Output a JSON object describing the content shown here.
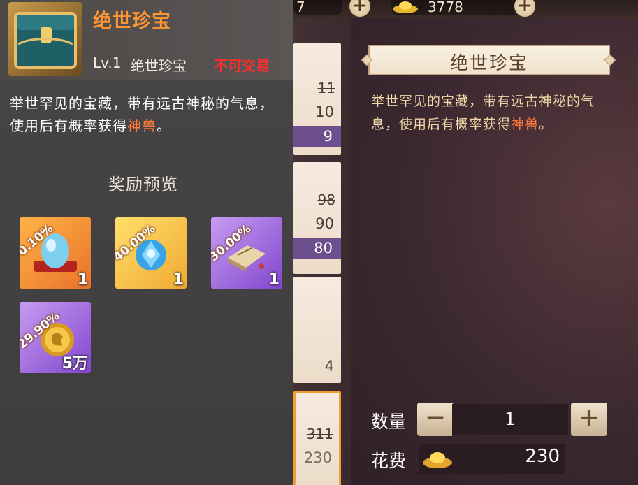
{
  "top_bar": {
    "currency_a_value": "7",
    "currency_b_value": "3778",
    "plus_symbol": "+"
  },
  "shop_list": {
    "items": [
      {
        "old_price": "11",
        "price": "10",
        "discount_price": "9"
      },
      {
        "old_price": "98",
        "price": "90",
        "discount_price": "80"
      },
      {
        "price": "4"
      },
      {
        "old_price": "311",
        "price": "230"
      }
    ]
  },
  "detail": {
    "title": "绝世珍宝",
    "description_before": "举世罕见的宝藏，带有远古神秘的气息，使用后有概率获得",
    "description_highlight": "神兽",
    "description_after": "。",
    "quantity_label": "数量",
    "quantity_value": "1",
    "minus_symbol": "−",
    "plus_symbol": "+",
    "cost_label": "花费",
    "cost_value": "230"
  },
  "tooltip": {
    "name": "绝世珍宝",
    "level": "Lv.1",
    "kind": "绝世珍宝",
    "trade_status": "不可交易",
    "description_before": "举世罕见的宝藏，带有远古神秘的气息，使用后有概率获得",
    "description_highlight": "神兽",
    "description_after": "。",
    "reward_title": "奖励预览",
    "rewards": [
      {
        "chance": "0.10%",
        "count": "1",
        "icon": "blue-egg-icon"
      },
      {
        "chance": "40.00%",
        "count": "1",
        "icon": "blue-crystal-icon"
      },
      {
        "chance": "30.00%",
        "count": "1",
        "icon": "ancient-book-icon"
      },
      {
        "chance": "29.90%",
        "count": "5万",
        "icon": "gold-coin-icon"
      }
    ]
  },
  "colors": {
    "accent_orange": "#ff9433",
    "highlight": "#ff7a3c",
    "untradeable_red": "#ff2c2c",
    "discount_purple": "#6d4f8e"
  }
}
